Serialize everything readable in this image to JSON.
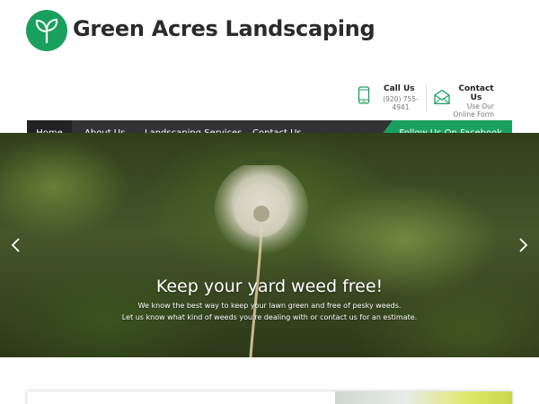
{
  "header": {
    "site_title": "Green Acres Landscaping",
    "logo_icon": "sprout-icon",
    "brand_color": "#1aa05e"
  },
  "contact_info": {
    "call": {
      "title": "Call Us",
      "number": "(920) 755-4941",
      "icon": "phone-icon"
    },
    "contact": {
      "title": "Contact Us",
      "subtitle": "Use Our Online Form",
      "icon": "envelope-icon"
    }
  },
  "nav": {
    "items": [
      {
        "label": "Home",
        "active": true
      },
      {
        "label": "About Us",
        "active": false
      },
      {
        "label": "Landscaping Services",
        "active": false
      },
      {
        "label": "Contact Us",
        "active": false
      }
    ],
    "facebook_label": "Follow Us On Facebook",
    "bar_color": "#333333",
    "facebook_color": "#1aa05e"
  },
  "hero": {
    "heading": "Keep your yard weed free!",
    "line1": "We know the best way to keep your lawn green and free of pesky weeds.",
    "line2": "Let us know what kind of weeds you're dealing with or contact us for an estimate.",
    "prev_icon": "chevron-left-icon",
    "next_icon": "chevron-right-icon"
  }
}
